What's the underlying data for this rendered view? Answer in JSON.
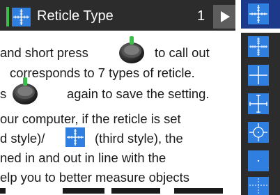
{
  "title_bar": {
    "title": "Reticle Type",
    "value": "1",
    "title_icon": "reticle-style-1-icon",
    "next_icon": "play-triangle-icon"
  },
  "instructions": {
    "line1": {
      "before": "and short press",
      "after": "to call out"
    },
    "line2": {
      "text": "corresponds to 7 types of reticle."
    },
    "line3": {
      "before": "s",
      "after": "again to save the setting."
    },
    "line4": {
      "text": "our computer, if the reticle is set"
    },
    "line5": {
      "before": "d style)/",
      "after": "(third style), the"
    },
    "line6": {
      "text": "ned in and out in line with the"
    },
    "line7": {
      "text": "elp you to better measure objects"
    },
    "line8": {
      "text": "...ahead  ..."
    }
  },
  "reticle_options": [
    {
      "name": "reticle-style-1",
      "icon": "ticked-crosshair-icon",
      "selected": true
    },
    {
      "name": "reticle-style-2",
      "icon": "dense-ticked-crosshair-icon",
      "selected": false
    },
    {
      "name": "reticle-style-3",
      "icon": "crosshair-icon",
      "selected": false
    },
    {
      "name": "reticle-style-4",
      "icon": "crosshair-ends-icon",
      "selected": false
    },
    {
      "name": "reticle-style-5",
      "icon": "circle-crosshair-icon",
      "selected": false
    },
    {
      "name": "reticle-style-6",
      "icon": "center-dot-icon",
      "selected": false
    },
    {
      "name": "reticle-style-7",
      "icon": "dotted-crosshair-icon",
      "selected": false
    }
  ],
  "colors": {
    "title_bar": "#2c2c2c",
    "accent_green": "#3bbf4a",
    "reticle_blue": "#2f7fe0",
    "selected_bg": "#1d3a8a",
    "text": "#1a1a1a"
  }
}
